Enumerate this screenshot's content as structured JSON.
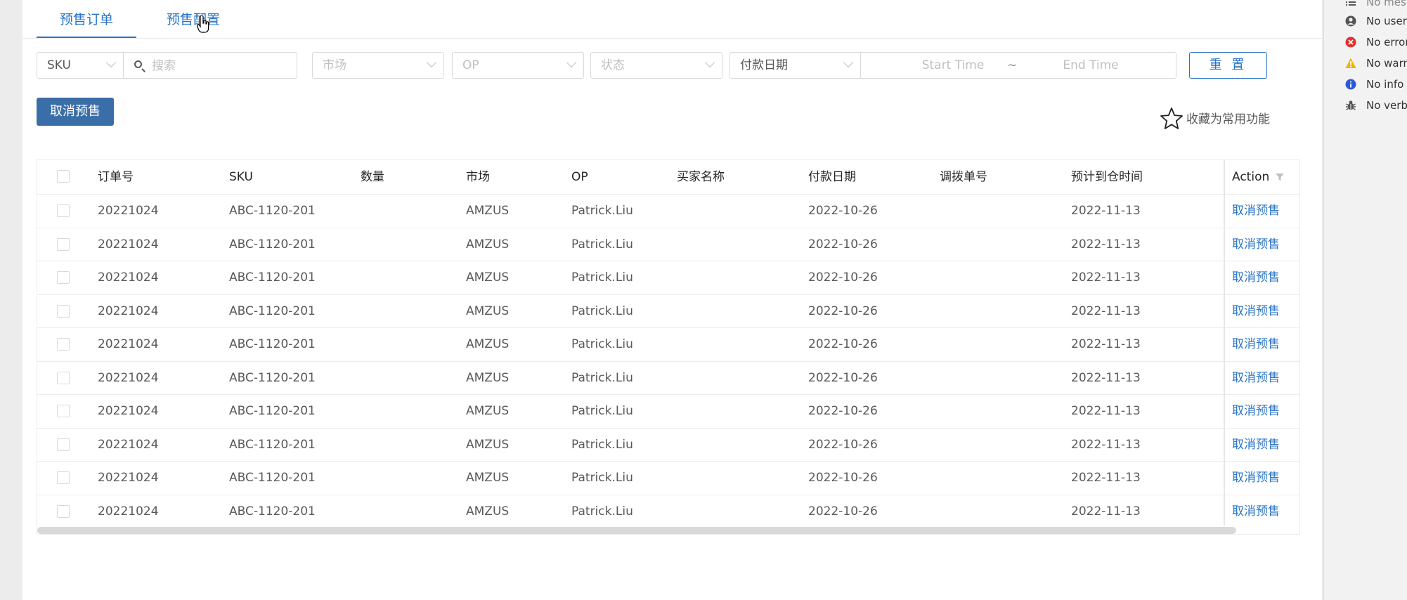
{
  "tabs": [
    {
      "label": "预售订单",
      "active": true
    },
    {
      "label": "预售配置",
      "active": false
    }
  ],
  "filters": {
    "sku_select": "SKU",
    "search_placeholder": "搜索",
    "market_placeholder": "市场",
    "op_placeholder": "OP",
    "status_placeholder": "状态",
    "date_type_select": "付款日期",
    "start_time_placeholder": "Start Time",
    "range_separator": "~",
    "end_time_placeholder": "End Time",
    "reset_label": "重 置"
  },
  "toolbar": {
    "cancel_presale_label": "取消预售",
    "favorite_label": "收藏为常用功能"
  },
  "table": {
    "columns": [
      "订单号",
      "SKU",
      "数量",
      "市场",
      "OP",
      "买家名称",
      "付款日期",
      "调拨单号",
      "预计到仓时间",
      "Action"
    ],
    "rows": [
      [
        "20221024",
        "ABC-1120-201",
        "",
        "AMZUS",
        "Patrick.Liu",
        "",
        "2022-10-26",
        "",
        "2022-11-13",
        "取消预售"
      ],
      [
        "20221024",
        "ABC-1120-201",
        "",
        "AMZUS",
        "Patrick.Liu",
        "",
        "2022-10-26",
        "",
        "2022-11-13",
        "取消预售"
      ],
      [
        "20221024",
        "ABC-1120-201",
        "",
        "AMZUS",
        "Patrick.Liu",
        "",
        "2022-10-26",
        "",
        "2022-11-13",
        "取消预售"
      ],
      [
        "20221024",
        "ABC-1120-201",
        "",
        "AMZUS",
        "Patrick.Liu",
        "",
        "2022-10-26",
        "",
        "2022-11-13",
        "取消预售"
      ],
      [
        "20221024",
        "ABC-1120-201",
        "",
        "AMZUS",
        "Patrick.Liu",
        "",
        "2022-10-26",
        "",
        "2022-11-13",
        "取消预售"
      ],
      [
        "20221024",
        "ABC-1120-201",
        "",
        "AMZUS",
        "Patrick.Liu",
        "",
        "2022-10-26",
        "",
        "2022-11-13",
        "取消预售"
      ],
      [
        "20221024",
        "ABC-1120-201",
        "",
        "AMZUS",
        "Patrick.Liu",
        "",
        "2022-10-26",
        "",
        "2022-11-13",
        "取消预售"
      ],
      [
        "20221024",
        "ABC-1120-201",
        "",
        "AMZUS",
        "Patrick.Liu",
        "",
        "2022-10-26",
        "",
        "2022-11-13",
        "取消预售"
      ],
      [
        "20221024",
        "ABC-1120-201",
        "",
        "AMZUS",
        "Patrick.Liu",
        "",
        "2022-10-26",
        "",
        "2022-11-13",
        "取消预售"
      ],
      [
        "20221024",
        "ABC-1120-201",
        "",
        "AMZUS",
        "Patrick.Liu",
        "",
        "2022-10-26",
        "",
        "2022-11-13",
        "取消预售"
      ]
    ]
  },
  "log_panel": {
    "items": [
      {
        "icon": "list-icon",
        "label": "No mes"
      },
      {
        "icon": "user-icon",
        "label": "No user"
      },
      {
        "icon": "error-icon",
        "label": "No error",
        "color": "#e03131"
      },
      {
        "icon": "warning-icon",
        "label": "No warn",
        "color": "#f0b400"
      },
      {
        "icon": "info-icon",
        "label": "No info",
        "color": "#2a5bd7"
      },
      {
        "icon": "bug-icon",
        "label": "No verb"
      }
    ]
  },
  "colors": {
    "accent": "#2a74c6",
    "primary_button": "#3a6ea8",
    "border": "#d9d9d9"
  }
}
